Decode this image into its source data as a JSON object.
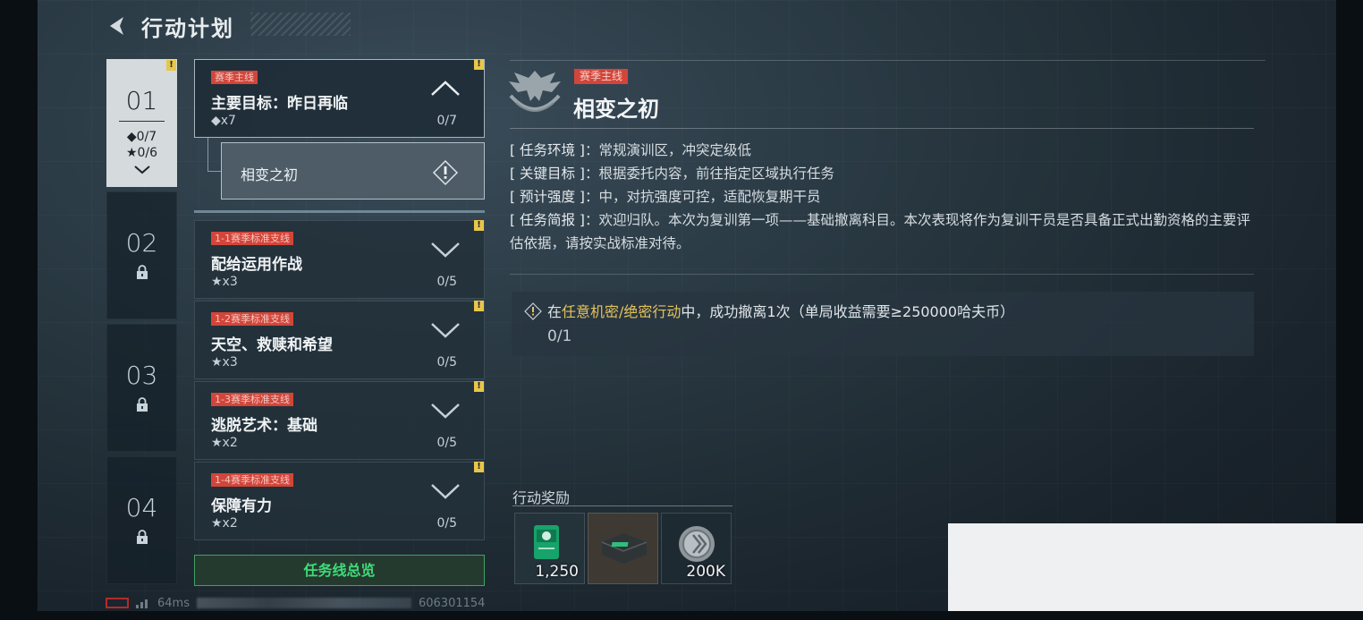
{
  "header": {
    "title": "行动计划",
    "back_icon": "back-arrow-icon"
  },
  "chapters": [
    {
      "num": "01",
      "diamond": "◆0/7",
      "star": "★0/6",
      "locked": false,
      "active": true
    },
    {
      "num": "02",
      "locked": true
    },
    {
      "num": "03",
      "locked": true
    },
    {
      "num": "04",
      "locked": true
    }
  ],
  "missions": [
    {
      "tag": "赛季主线",
      "title": "主要目标：昨日再临",
      "count": "◆x7",
      "progress": "0/7",
      "expanded": true
    },
    {
      "tag": "1-1赛季标准支线",
      "title": "配给运用作战",
      "count": "★x3",
      "progress": "0/5"
    },
    {
      "tag": "1-2赛季标准支线",
      "title": "天空、救赎和希望",
      "count": "★x3",
      "progress": "0/5"
    },
    {
      "tag": "1-3赛季标准支线",
      "title": "逃脱艺术：基础",
      "count": "★x2",
      "progress": "0/5"
    },
    {
      "tag": "1-4赛季标准支线",
      "title": "保障有力",
      "count": "★x2",
      "progress": "0/5"
    }
  ],
  "sub_mission": {
    "title": "相变之初"
  },
  "overview_button": "任务线总览",
  "detail": {
    "tag": "赛季主线",
    "title": "相变之初",
    "info": [
      {
        "label": "[ 任务环境 ]",
        "text": "：常规演训区，冲突定级低"
      },
      {
        "label": "[ 关键目标 ]",
        "text": "：根据委托内容，前往指定区域执行任务"
      },
      {
        "label": "[ 预计强度 ]",
        "text": "：中，对抗强度可控，适配恢复期干员"
      },
      {
        "label": "[ 任务简报 ]",
        "text": "：欢迎归队。本次为复训第一项——基础撤离科目。本次表现将作为复训干员是否具备正式出勤资格的主要评估依据，请按实战标准对待。"
      }
    ],
    "objective": {
      "prefix": "在",
      "highlight": "任意机密/绝密行动",
      "suffix": "中，成功撤离1次（单局收益需要≥250000哈夫币）",
      "progress": "0/1"
    }
  },
  "rewards": {
    "label": "行动奖励",
    "items": [
      {
        "icon": "badge-token-icon",
        "qty": "1,250"
      },
      {
        "icon": "supply-case-icon",
        "qty": ""
      },
      {
        "icon": "coin-icon",
        "qty": "200K"
      }
    ]
  },
  "status": {
    "ping": "64ms",
    "uid": "606301154"
  },
  "colors": {
    "accent_red": "#d2453a",
    "highlight_gold": "#e5c25a",
    "green": "#3ddc78",
    "warn_yellow": "#e8c64a"
  }
}
